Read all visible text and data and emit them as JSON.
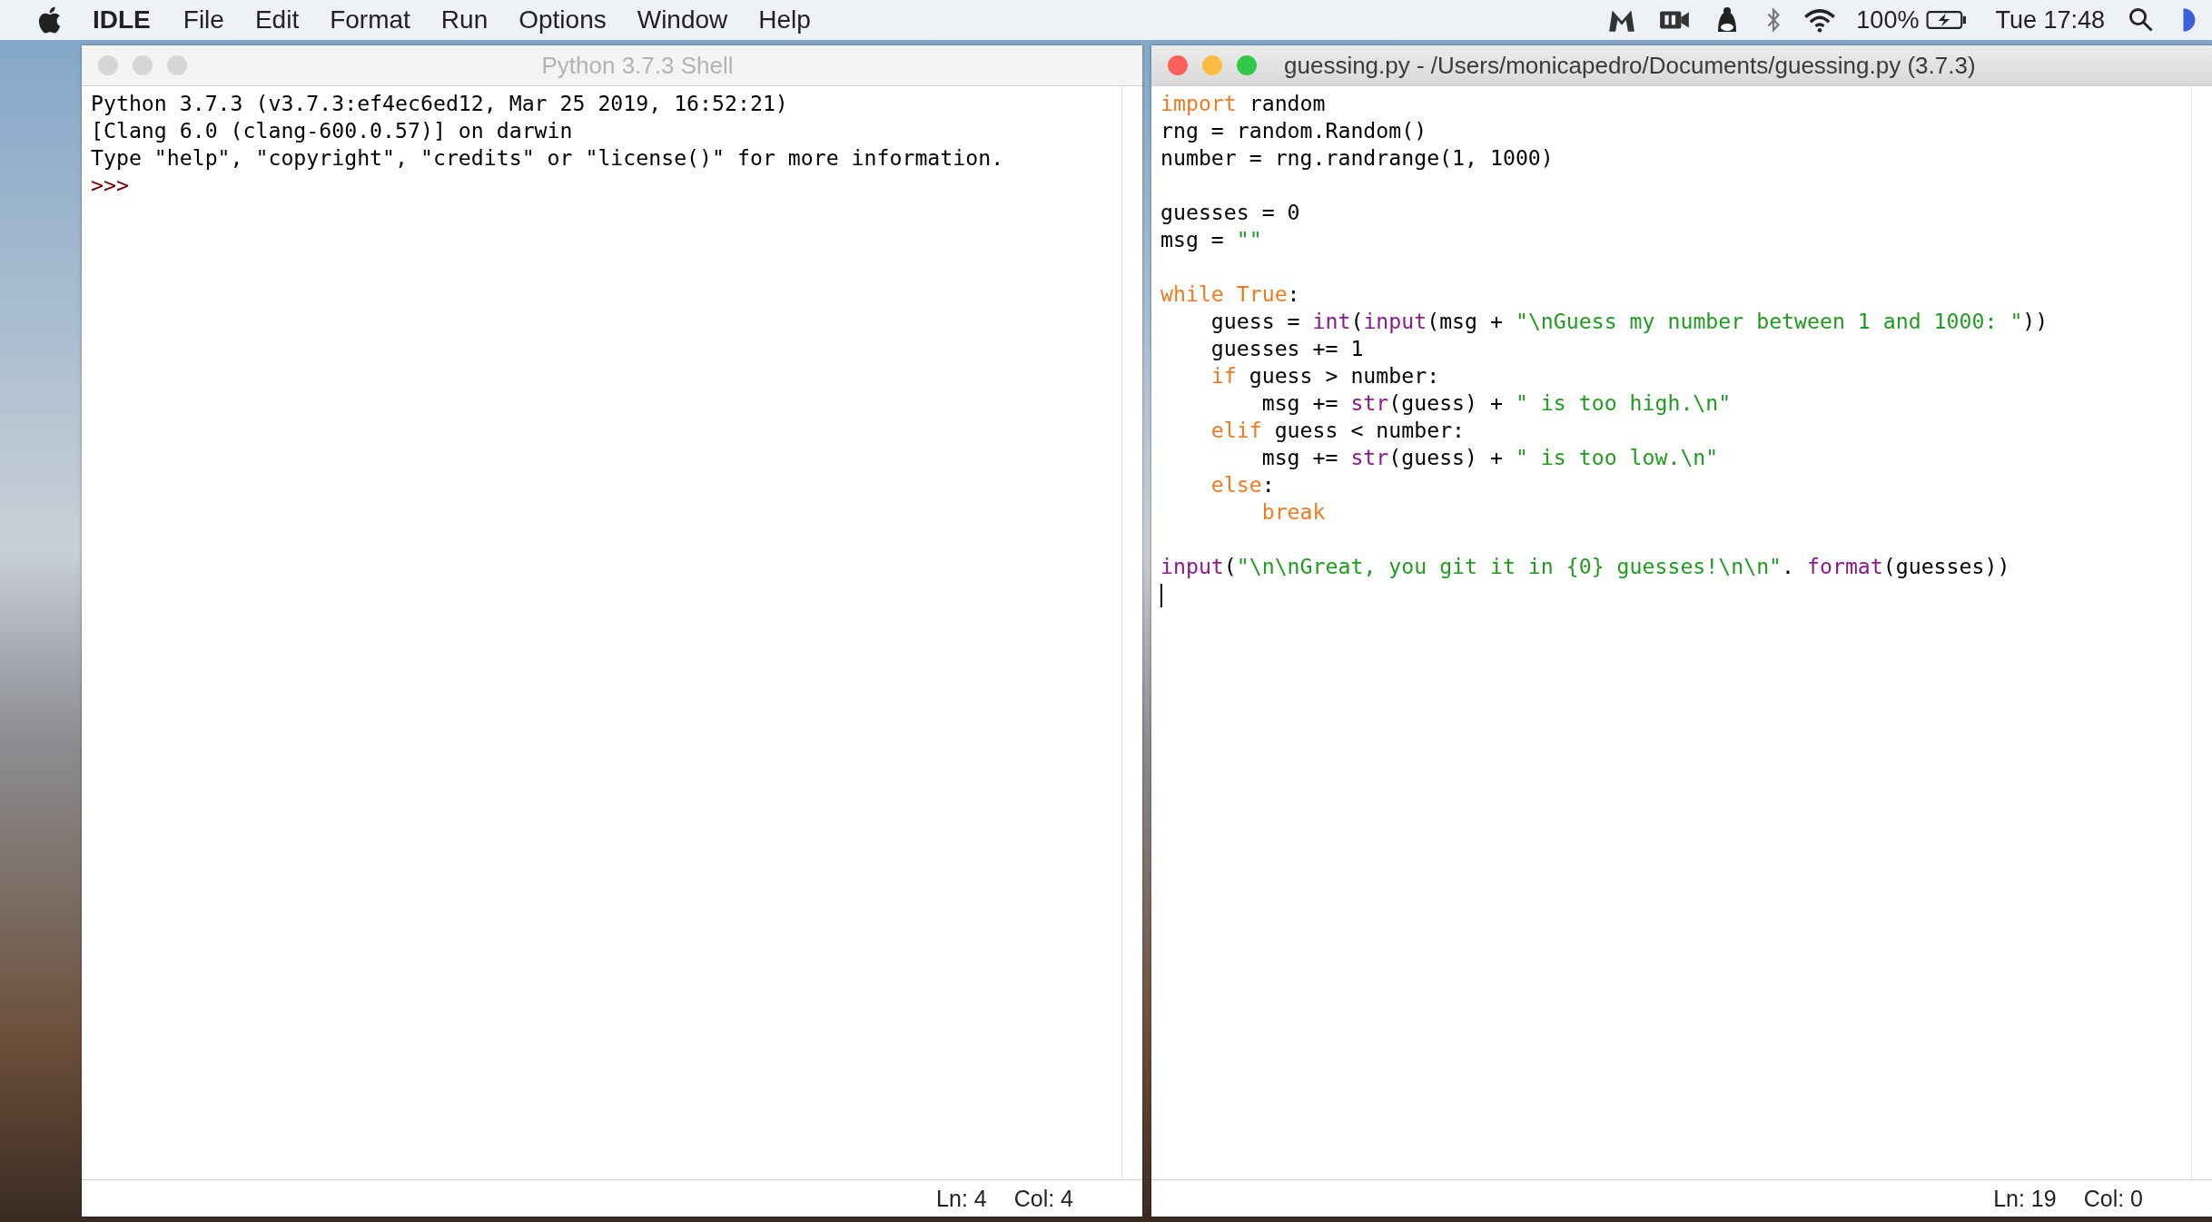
{
  "menu_bar": {
    "app_name": "IDLE",
    "menus": [
      "File",
      "Edit",
      "Format",
      "Run",
      "Options",
      "Window",
      "Help"
    ],
    "battery_percent": "100%",
    "clock": "Tue 17:48"
  },
  "shell": {
    "title": "Python 3.7.3 Shell",
    "focused": false,
    "output": [
      "Python 3.7.3 (v3.7.3:ef4ec6ed12, Mar 25 2019, 16:52:21)",
      "[Clang 6.0 (clang-600.0.57)] on darwin",
      "Type \"help\", \"copyright\", \"credits\" or \"license()\" for more information."
    ],
    "prompt": ">>>",
    "status": {
      "line": "Ln: 4",
      "column": "Col: 4"
    }
  },
  "editor": {
    "title": "guessing.py - /Users/monicapedro/Documents/guessing.py (3.7.3)",
    "focused": true,
    "lines": [
      {
        "kind": "code",
        "tokens": [
          {
            "t": "import",
            "kind": "keyword"
          },
          {
            "t": " random",
            "kind": "plain"
          }
        ]
      },
      {
        "kind": "code",
        "tokens": [
          {
            "t": "rng = random.Random()",
            "kind": "plain"
          }
        ]
      },
      {
        "kind": "code",
        "tokens": [
          {
            "t": "number = rng.randrange(1, 1000)",
            "kind": "plain"
          }
        ]
      },
      {
        "kind": "blank"
      },
      {
        "kind": "code",
        "tokens": [
          {
            "t": "guesses = 0",
            "kind": "plain"
          }
        ]
      },
      {
        "kind": "code",
        "tokens": [
          {
            "t": "msg = ",
            "kind": "plain"
          },
          {
            "t": "\"\"",
            "kind": "string"
          }
        ]
      },
      {
        "kind": "blank"
      },
      {
        "kind": "code",
        "tokens": [
          {
            "t": "while True",
            "kind": "keyword"
          },
          {
            "t": ":",
            "kind": "plain"
          }
        ]
      },
      {
        "kind": "code",
        "tokens": [
          {
            "t": "    guess = ",
            "kind": "plain"
          },
          {
            "t": "int",
            "kind": "builtin"
          },
          {
            "t": "(",
            "kind": "plain"
          },
          {
            "t": "input",
            "kind": "builtin"
          },
          {
            "t": "(msg + ",
            "kind": "plain"
          },
          {
            "t": "\"\\nGuess my number between 1 and 1000: \"",
            "kind": "string"
          },
          {
            "t": "))",
            "kind": "plain"
          }
        ]
      },
      {
        "kind": "code",
        "tokens": [
          {
            "t": "    guesses += 1",
            "kind": "plain"
          }
        ]
      },
      {
        "kind": "code",
        "tokens": [
          {
            "t": "    if",
            "kind": "keyword"
          },
          {
            "t": " guess > number:",
            "kind": "plain"
          }
        ]
      },
      {
        "kind": "code",
        "tokens": [
          {
            "t": "        msg += ",
            "kind": "plain"
          },
          {
            "t": "str",
            "kind": "builtin"
          },
          {
            "t": "(guess) + ",
            "kind": "plain"
          },
          {
            "t": "\" is too high.\\n\"",
            "kind": "string"
          }
        ]
      },
      {
        "kind": "code",
        "tokens": [
          {
            "t": "    elif",
            "kind": "keyword"
          },
          {
            "t": " guess < number:",
            "kind": "plain"
          }
        ]
      },
      {
        "kind": "code",
        "tokens": [
          {
            "t": "        msg += ",
            "kind": "plain"
          },
          {
            "t": "str",
            "kind": "builtin"
          },
          {
            "t": "(guess) + ",
            "kind": "plain"
          },
          {
            "t": "\" is too low.\\n\"",
            "kind": "string"
          }
        ]
      },
      {
        "kind": "code",
        "tokens": [
          {
            "t": "    else",
            "kind": "keyword"
          },
          {
            "t": ":",
            "kind": "plain"
          }
        ]
      },
      {
        "kind": "code",
        "tokens": [
          {
            "t": "        break",
            "kind": "keyword"
          }
        ]
      },
      {
        "kind": "blank"
      },
      {
        "kind": "code",
        "tokens": [
          {
            "t": "input",
            "kind": "builtin"
          },
          {
            "t": "(",
            "kind": "plain"
          },
          {
            "t": "\"\\n\\nGreat, you git it in {0} guesses!\\n\\n\"",
            "kind": "string"
          },
          {
            "t": ". ",
            "kind": "plain"
          },
          {
            "t": "format",
            "kind": "builtin"
          },
          {
            "t": "(guesses))",
            "kind": "plain"
          }
        ]
      }
    ],
    "status": {
      "line": "Ln: 19",
      "column": "Col: 0"
    }
  }
}
